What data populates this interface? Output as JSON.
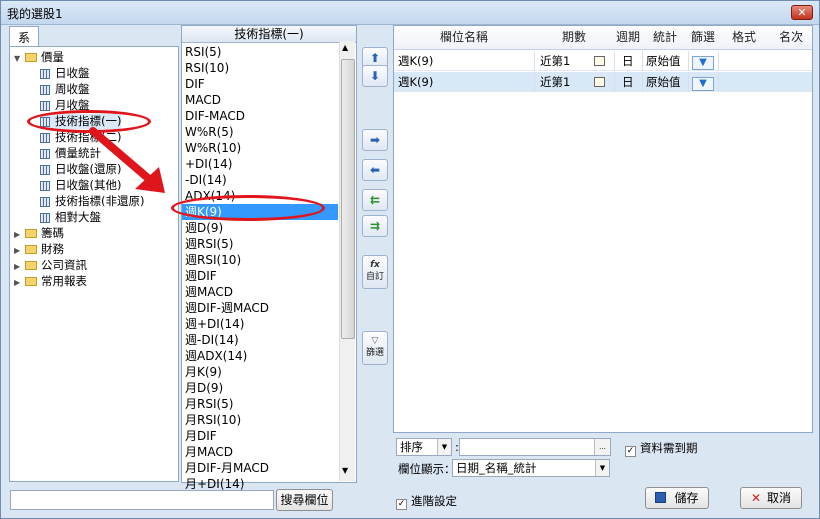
{
  "window": {
    "title": "我的選股1",
    "close_label": "✕"
  },
  "tabs": [
    {
      "label": "系統"
    }
  ],
  "tree": {
    "root": "價量",
    "children": [
      "日收盤",
      "周收盤",
      "月收盤",
      "技術指標(一)",
      "技術指標(二)",
      "價量統計",
      "日收盤(還原)",
      "日收盤(其他)",
      "技術指標(非還原)",
      "相對大盤"
    ],
    "others": [
      "籌碼",
      "財務",
      "公司資訊",
      "常用報表"
    ]
  },
  "indicators": {
    "header": "技術指標(一)",
    "items": [
      "RSI(5)",
      "RSI(10)",
      "DIF",
      "MACD",
      "DIF-MACD",
      "W%R(5)",
      "W%R(10)",
      "+DI(14)",
      "-DI(14)",
      "ADX(14)",
      "週K(9)",
      "週D(9)",
      "週RSI(5)",
      "週RSI(10)",
      "週DIF",
      "週MACD",
      "週DIF-週MACD",
      "週+DI(14)",
      "週-DI(14)",
      "週ADX(14)",
      "月K(9)",
      "月D(9)",
      "月RSI(5)",
      "月RSI(10)",
      "月DIF",
      "月MACD",
      "月DIF-月MACD",
      "月+DI(14)"
    ],
    "selected_index": 10
  },
  "mid_buttons": {
    "up": "⬆",
    "down": "⬇",
    "add": "➡",
    "remove": "⬅",
    "add_all": "⇇",
    "remove_all": "⇉",
    "custom_icon": "fx",
    "custom_label": "自訂",
    "filter_label": "篩選"
  },
  "grid": {
    "columns": [
      "欄位名稱",
      "期數",
      "週期",
      "統計",
      "篩選",
      "格式",
      "名次"
    ],
    "rows": [
      {
        "name": "週K(9)",
        "period": "近第1",
        "cycle": "日",
        "stat": "原始值"
      },
      {
        "name": "週K(9)",
        "period": "近第1",
        "cycle": "日",
        "stat": "原始值"
      }
    ]
  },
  "bottom": {
    "sort_label": "排序",
    "sort_value": "",
    "ellipsis": "...",
    "need_expire_label": "資料需到期",
    "need_expire_checked": true,
    "display_label": "欄位顯示：",
    "display_value": "日期_名稱_統計",
    "search_placeholder": "",
    "search_button": "搜尋欄位",
    "advanced_label": "進階設定",
    "advanced_checked": true,
    "save_label": "儲存",
    "cancel_label": "取消"
  },
  "colors": {
    "selection": "#3399ff",
    "highlight_ring": "#e0141b",
    "row_selected": "#d9e8f7"
  }
}
